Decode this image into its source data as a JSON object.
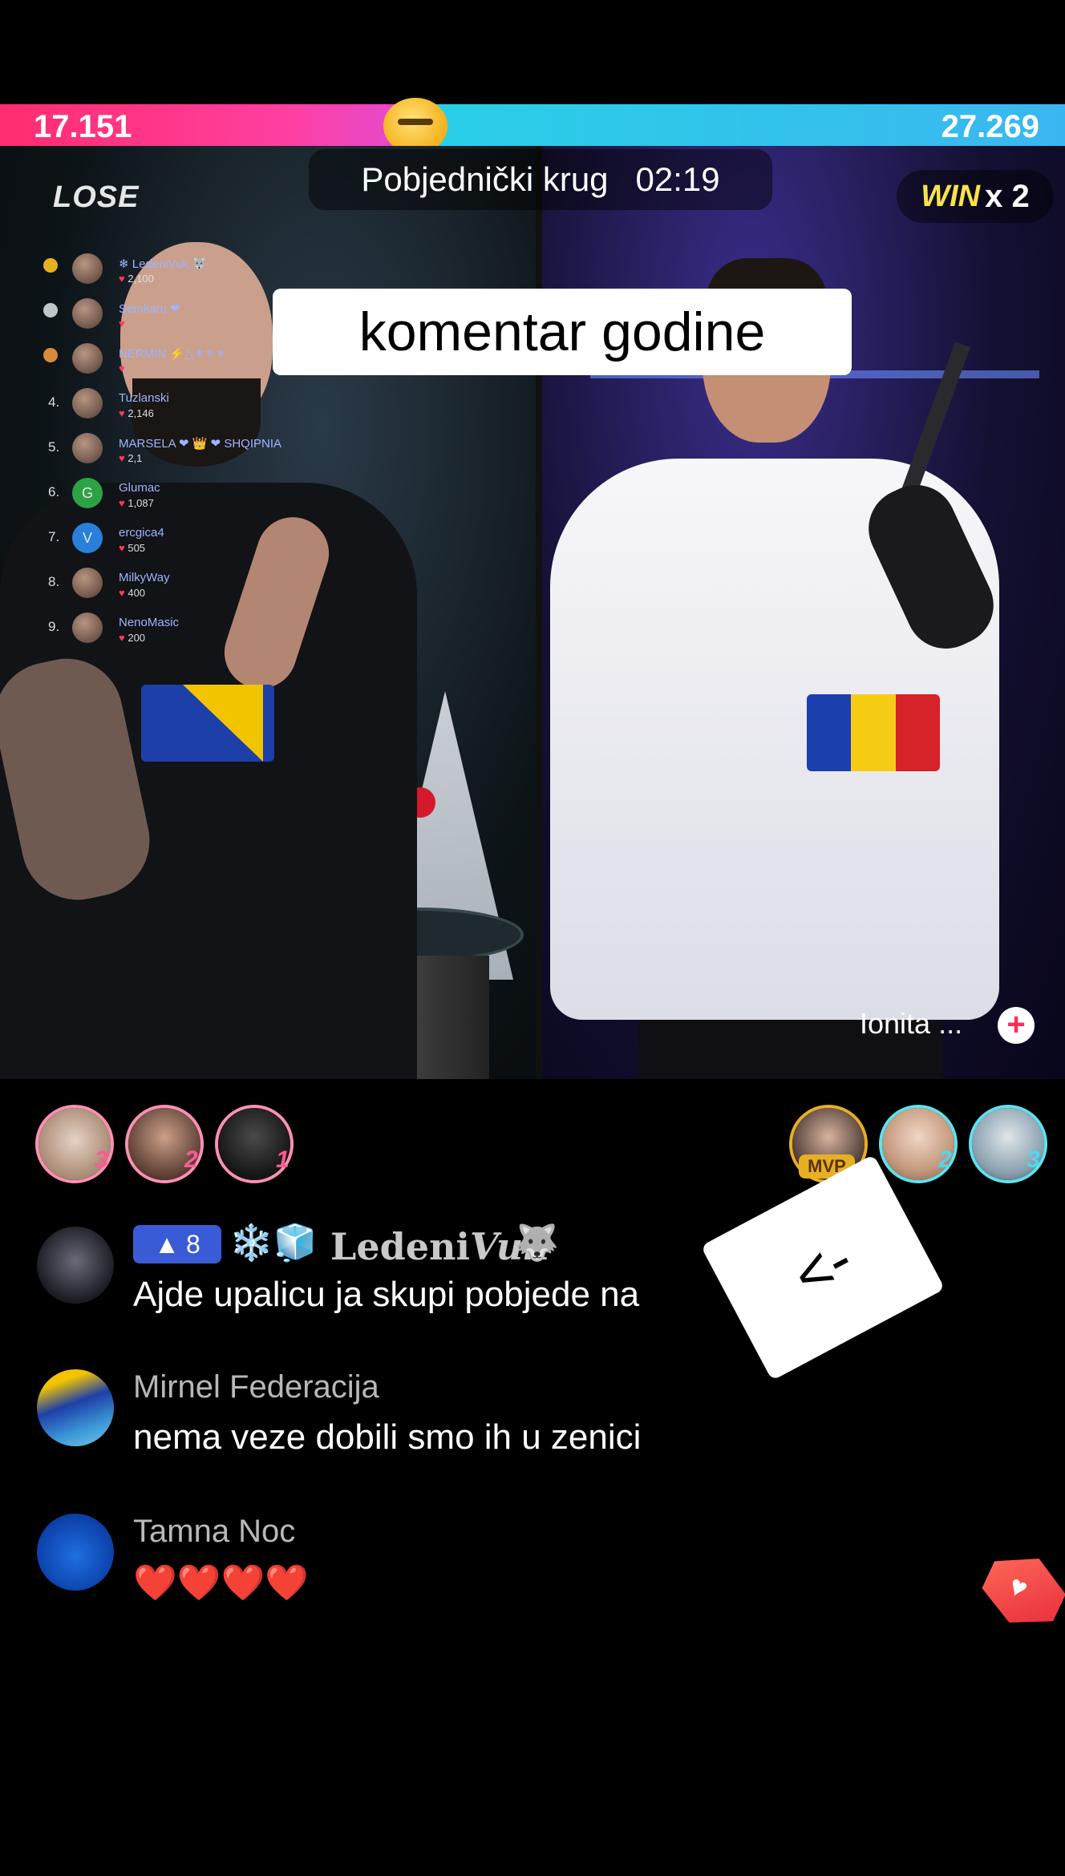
{
  "battle": {
    "left_score": "17.151",
    "right_score": "27.269",
    "round_label": "Pobjednički krug",
    "timer": "02:19",
    "left_result": "LOSE",
    "right_result": "WIN",
    "right_multiplier": "x 2",
    "colors": {
      "left": "#ff2d6f",
      "right": "#29d0e6"
    }
  },
  "caption": "komentar godine",
  "ranking": [
    {
      "rank": "",
      "name": "❄ LedeniVuk 🐺",
      "score": "2,100"
    },
    {
      "rank": "",
      "name": "Semkaru ❤",
      "score": ""
    },
    {
      "rank": "",
      "name": "NERMIN ⚡△⚜⚜⚜",
      "score": ""
    },
    {
      "rank": "4.",
      "name": "Tuzlanski",
      "score": "2,146"
    },
    {
      "rank": "5.",
      "name": "MARSELA ❤ 👑 ❤ SHQIPNIA",
      "score": "2,1"
    },
    {
      "rank": "6.",
      "name": "Glumac",
      "score": "1,087",
      "initial": "G"
    },
    {
      "rank": "7.",
      "name": "ercgica4",
      "score": "505",
      "initial": "V"
    },
    {
      "rank": "8.",
      "name": "MilkyWay",
      "score": "400"
    },
    {
      "rank": "9.",
      "name": "NenoMasic",
      "score": "200"
    }
  ],
  "opponent": {
    "name": "Ionita ...",
    "follow_icon": "plus-icon"
  },
  "gifters_left": [
    {
      "rank": "3"
    },
    {
      "rank": "2"
    },
    {
      "rank": "1"
    }
  ],
  "gifters_right": [
    {
      "rank": "MVP"
    },
    {
      "rank": "2"
    },
    {
      "rank": "3"
    }
  ],
  "comments": [
    {
      "level": "8",
      "icons": "❄️🧊",
      "name_plain": "Ledeni",
      "name_italic": "Vuk",
      "emoji": "🐺",
      "text": "Ajde upalicu ja skupi pobjede na"
    },
    {
      "name": "Mirnel Federacija",
      "text": "nema veze dobili smo ih u zenici"
    },
    {
      "name": "Tamna Noc",
      "text": "❤️❤️❤️❤️"
    }
  ],
  "sticker_text": "<-",
  "like_icon": "heart-gem-icon"
}
